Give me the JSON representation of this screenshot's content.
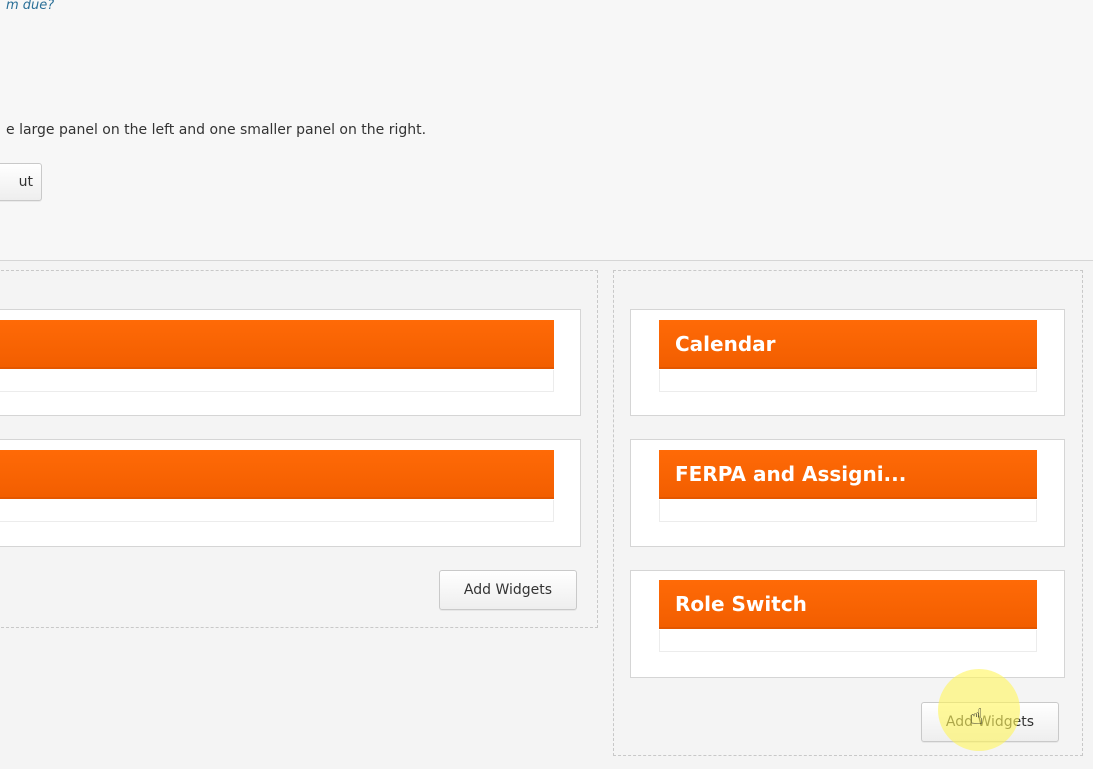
{
  "top": {
    "cut_link_text": "m due?",
    "layout_description": "e large panel on the left and one smaller panel on the right.",
    "layout_button_label": "ut"
  },
  "left_panel": {
    "widgets": [
      {
        "title": ""
      },
      {
        "title": ""
      }
    ],
    "add_widgets_label": "Add Widgets"
  },
  "right_panel": {
    "widgets": [
      {
        "title": "Calendar"
      },
      {
        "title": "FERPA and Assigni..."
      },
      {
        "title": "Role Switch"
      }
    ],
    "add_widgets_label": "Add Widgets"
  },
  "colors": {
    "widget_header": "#ff6a07",
    "cursor_highlight": "#fff55a"
  },
  "icons": {
    "cursor": "hand-pointer-icon"
  }
}
